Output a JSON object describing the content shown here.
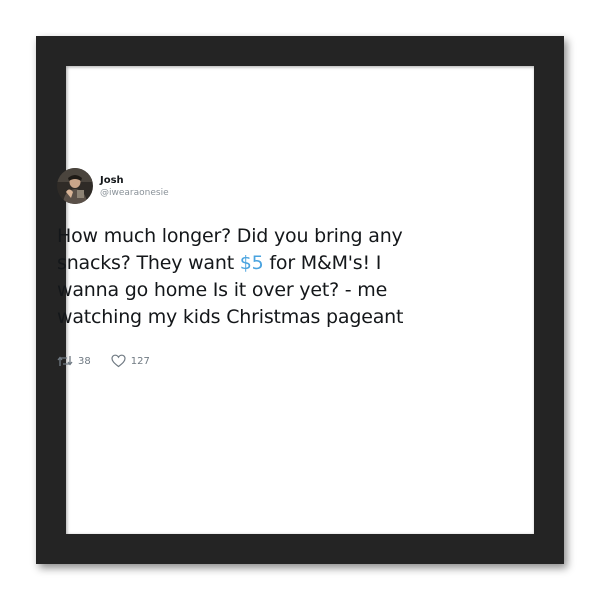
{
  "tweet": {
    "display_name": "Josh",
    "handle": "@iwearaonesie",
    "text_part1": "How much longer? Did you bring any snacks? They want ",
    "price": "$5",
    "text_part2": " for M&M's! I wanna go home Is it over yet? - me watching my kids Christmas pageant",
    "retweets": "38",
    "likes": "127"
  },
  "icons": {
    "retweet": "retweet-icon",
    "like": "heart-icon",
    "avatar": "profile-photo"
  },
  "colors": {
    "frame": "#242424",
    "mat": "#ffffff",
    "text": "#14171a",
    "link": "#4aa3df",
    "muted": "#8a9299"
  }
}
